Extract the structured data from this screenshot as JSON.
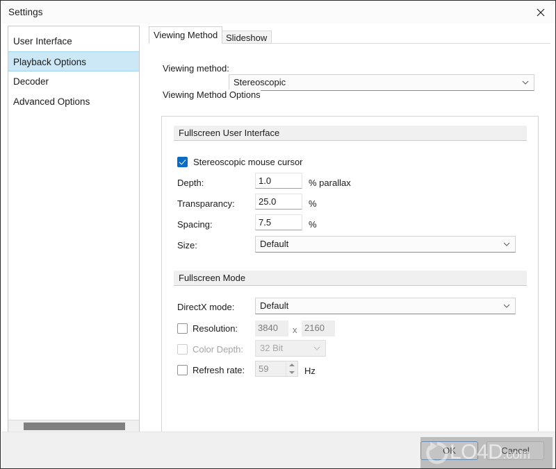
{
  "window": {
    "title": "Settings",
    "close_icon": "close-icon"
  },
  "sidebar": {
    "items": [
      {
        "label": "User Interface",
        "selected": false
      },
      {
        "label": "Playback Options",
        "selected": true
      },
      {
        "label": "Decoder",
        "selected": false
      },
      {
        "label": "Advanced Options",
        "selected": false
      }
    ],
    "scrollbar": {
      "orientation": "horizontal"
    }
  },
  "tabs": [
    {
      "label": "Viewing Method",
      "active": true
    },
    {
      "label": "Slideshow",
      "active": false
    }
  ],
  "viewing_method": {
    "label": "Viewing method:",
    "value": "Stereoscopic",
    "chevron_icon": "chevron-down-icon"
  },
  "options_group": {
    "caption": "Viewing Method Options",
    "fullscreen_ui": {
      "header": "Fullscreen User Interface",
      "stereo_cursor": {
        "label": "Stereoscopic mouse cursor",
        "checked": true
      },
      "depth": {
        "label": "Depth:",
        "value": "1.0",
        "unit": "% parallax"
      },
      "transparancy": {
        "label": "Transparancy:",
        "value": "25.0",
        "unit": "%"
      },
      "spacing": {
        "label": "Spacing:",
        "value": "7.5",
        "unit": "%"
      },
      "size": {
        "label": "Size:",
        "value": "Default",
        "chevron_icon": "chevron-down-icon"
      }
    },
    "fullscreen_mode": {
      "header": "Fullscreen Mode",
      "directx": {
        "label": "DirectX mode:",
        "value": "Default",
        "chevron_icon": "chevron-down-icon"
      },
      "resolution": {
        "label": "Resolution:",
        "checked": false,
        "width": "3840",
        "separator": "x",
        "height": "2160"
      },
      "color_depth": {
        "label": "Color Depth:",
        "checked": false,
        "value": "32 Bit",
        "chevron_icon": "chevron-down-icon"
      },
      "refresh_rate": {
        "label": "Refresh rate:",
        "checked": false,
        "value": "59",
        "unit": "Hz"
      }
    }
  },
  "footer": {
    "ok_label": "OK",
    "cancel_label": "Cancel"
  },
  "watermark": {
    "text": "LO4D",
    "suffix": ".com",
    "logo_icon": "refresh-circle-icon"
  }
}
